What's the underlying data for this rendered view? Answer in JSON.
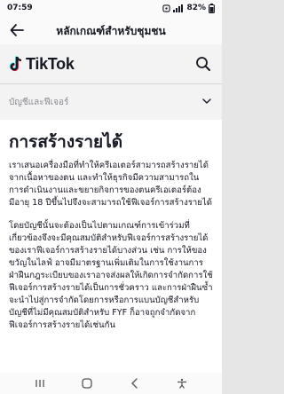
{
  "status": {
    "time": "07:59",
    "battery": "82%"
  },
  "header": {
    "title": "หลักเกณฑ์สำหรับชุมชน"
  },
  "brand": {
    "name": "TikTok"
  },
  "account": {
    "label": "บัญชีและฟีเจอร์"
  },
  "article": {
    "title": "การสร้างรายได้",
    "paragraphs": [
      "เราเสนอเครื่องมือที่ทำให้ครีเอเตอร์สามารถสร้างรายได้จากเนื้อหาของตน และทำให้ธุรกิจมีความสามารถในการดำเนินงานและขยายกิจการของตนครีเอเตอร์ต้องมีอายุ 18 ปีขึ้นไปจึงจะสามารถใช้ฟีเจอร์การสร้างรายได้",
      "โดยบัญชีนั้นจะต้องเป็นไปตามเกณฑ์การเข้าร่วมที่เกี่ยวข้องจึงจะมีคุณสมบัติสำหรับฟีเจอร์การสร้างรายได้ของเราฟีเจอร์การสร้างรายได้บางส่วน เช่น การให้ของขวัญในไลฟ์ อาจมีมาตรฐานเพิ่มเติมในการใช้งานการฝ่าฝืนกฎระเบียบของเราอาจส่งผลให้เกิดการจำกัดการใช้ฟีเจอร์การสร้างรายได้เป็นการชั่วคราว และการฝ่าฝืนซ้ำจะนำไปสู่การจำกัดโดยการหรือการแบนบัญชีสำหรับบัญชีที่ไม่มีคุณสมบัติสำหรับ FYF ก็อาจถูกจำกัดจากฟีเจอร์การสร้างรายได้เช่นกัน"
    ]
  },
  "colors": {
    "text": "#161823",
    "muted": "#8a8b91",
    "card": "#ffffff"
  }
}
